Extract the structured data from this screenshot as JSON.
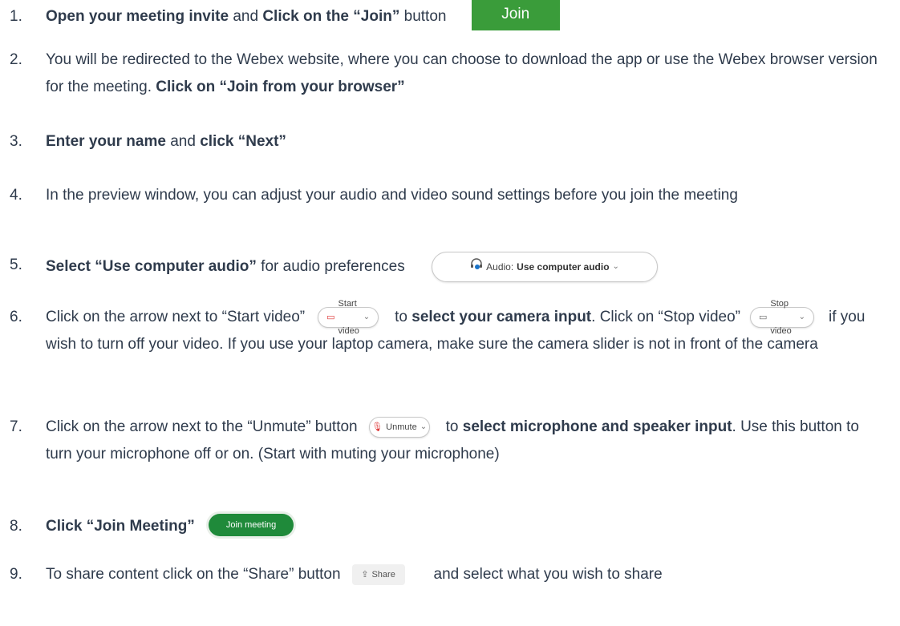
{
  "steps": [
    {
      "num": "1.",
      "b1": "Open your meeting invite",
      "t1": " and ",
      "b2": "Click on the “Join”",
      "t2": " button",
      "btn": "Join"
    },
    {
      "num": "2.",
      "t1": "You will be redirected to the Webex website, where you can choose to download the app or use the Webex browser version for the meeting. ",
      "b1": "Click on “Join from your browser”"
    },
    {
      "num": "3.",
      "b1": "Enter your name",
      "t1": " and ",
      "b2": "click “Next”"
    },
    {
      "num": "4.",
      "t1": "In the preview window, you can adjust your audio and video sound settings before you join the meeting"
    },
    {
      "num": "5.",
      "b1": "Select “Use computer audio”",
      "t1": " for audio preferences",
      "pill_prefix": "Audio: ",
      "pill_bold": "Use computer audio"
    },
    {
      "num": "6.",
      "t1": "Click on the arrow next to “Start video”",
      "pill1": "Start video",
      "t2": "to ",
      "b1": "select your camera input",
      "t3": ". Click on “Stop video”",
      "pill2": "Stop video",
      "t4": "if you wish to turn off your video. If you use your laptop camera, make sure the camera slider is not in front of the camera"
    },
    {
      "num": "7.",
      "t1": "Click on the arrow next to the “Unmute” button",
      "pill": "Unmute",
      "t2": "to ",
      "b1": "select microphone and speaker input",
      "t3": ". Use this button to turn your microphone off or on. (Start with muting your microphone)"
    },
    {
      "num": "8.",
      "b1": "Click “Join Meeting”",
      "btn": "Join meeting"
    },
    {
      "num": "9.",
      "t1": "To share content click on the “Share” button",
      "btn": "Share",
      "t2": "and select what you wish to share"
    }
  ],
  "icons": {
    "headset": "headset-icon",
    "video": "video-icon",
    "video_off": "video-off-icon",
    "mic": "microphone-icon",
    "share": "share-icon",
    "chevron": "chevron-down-icon"
  },
  "colors": {
    "join_green": "#3a9c3a",
    "join_meeting_green": "#1f8a3a",
    "text": "#2f3b4c"
  }
}
